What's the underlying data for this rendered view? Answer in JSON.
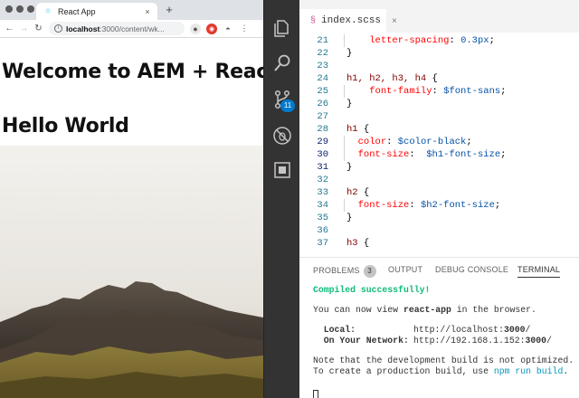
{
  "browser": {
    "tab_title": "React App",
    "tab_close": "×",
    "new_tab": "+",
    "url_host": "localhost",
    "url_path": ":3000/content/wk...",
    "page": {
      "heading1": "Welcome to AEM + React",
      "heading2": "Hello World"
    }
  },
  "editor": {
    "file_tab": "index.scss",
    "scm_badge": "11",
    "lines": [
      {
        "n": "21",
        "text": "    letter-spacing: 0.3px;"
      },
      {
        "n": "22",
        "text": "}"
      },
      {
        "n": "23",
        "text": ""
      },
      {
        "n": "24",
        "text": "h1, h2, h3, h4 {"
      },
      {
        "n": "25",
        "text": "    font-family: $font-sans;"
      },
      {
        "n": "26",
        "text": "}"
      },
      {
        "n": "27",
        "text": ""
      },
      {
        "n": "28",
        "text": "h1 {"
      },
      {
        "n": "29",
        "text": "  color: $color-black;"
      },
      {
        "n": "30",
        "text": "  font-size:  $h1-font-size;"
      },
      {
        "n": "31",
        "text": "}"
      },
      {
        "n": "32",
        "text": ""
      },
      {
        "n": "33",
        "text": "h2 {"
      },
      {
        "n": "34",
        "text": "  font-size: $h2-font-size;"
      },
      {
        "n": "35",
        "text": "}"
      },
      {
        "n": "36",
        "text": ""
      },
      {
        "n": "37",
        "text": "h3 {"
      }
    ]
  },
  "panel": {
    "tabs": {
      "problems": "PROBLEMS",
      "problems_count": "3",
      "output": "OUTPUT",
      "debug": "DEBUG CONSOLE",
      "terminal": "TERMINAL"
    },
    "terminal": {
      "compiled": "Compiled successfully!",
      "view_pre": "You can now view ",
      "view_app": "react-app",
      "view_post": " in the browser.",
      "local_label": "  Local:",
      "local_url_pre": "http://localhost:",
      "local_url_port": "3000",
      "local_url_post": "/",
      "network_label": "  On Your Network:",
      "network_url_pre": "http://192.168.1.152:",
      "network_url_port": "3000",
      "network_url_post": "/",
      "note1": "Note that the development build is not optimized.",
      "note2_pre": "To create a production build, use ",
      "note2_cmd": "npm run build",
      "note2_post": "."
    }
  },
  "colors": {
    "activity_bar": "#333333",
    "scm_badge": "#007acc",
    "terminal_success": "#0dbc79",
    "terminal_link": "#0598bc"
  }
}
